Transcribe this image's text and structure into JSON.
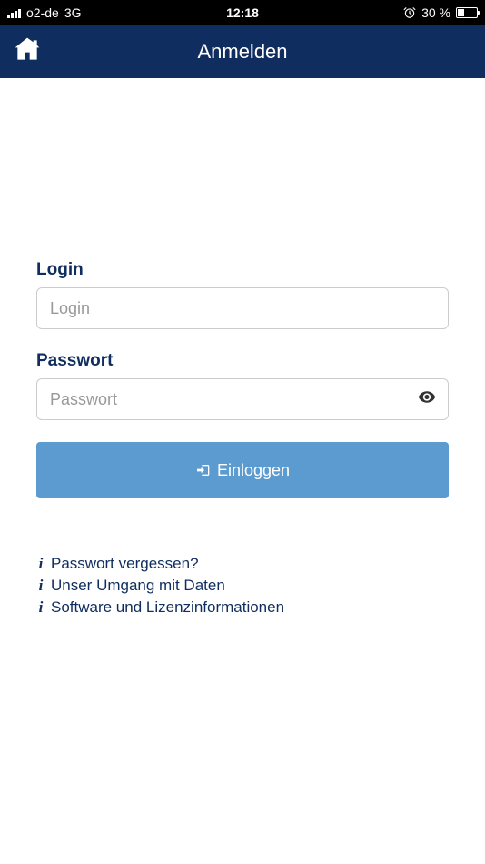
{
  "statusBar": {
    "carrier": "o2-de",
    "network": "3G",
    "time": "12:18",
    "battery": "30 %"
  },
  "header": {
    "title": "Anmelden"
  },
  "form": {
    "loginLabel": "Login",
    "loginPlaceholder": "Login",
    "passwordLabel": "Passwort",
    "passwordPlaceholder": "Passwort",
    "submitLabel": "Einloggen"
  },
  "links": {
    "forgotPassword": "Passwort vergessen?",
    "dataHandling": "Unser Umgang mit Daten",
    "licenseInfo": "Software und Lizenzinformationen"
  }
}
